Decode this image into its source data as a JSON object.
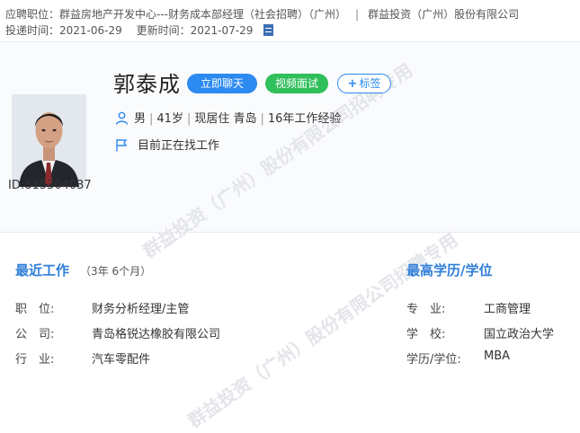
{
  "header": {
    "applied_label": "应聘职位：",
    "applied_position": "群益房地产开发中心---财务成本部经理（社会招聘）（广州）",
    "separator": "|",
    "company": "群益投资（广州）股份有限公司",
    "submit_label": "投递时间：",
    "submit_date": "2021-06-29",
    "update_label": "更新时间：",
    "update_date": "2021-07-29"
  },
  "profile": {
    "name": "郭泰成",
    "chat_button": "立即聊天",
    "video_button": "视频面试",
    "tag_button": "标签",
    "tag_plus": "+",
    "gender": "男",
    "age": "41岁",
    "residence": "现居住 青岛",
    "experience": "16年工作经验",
    "status": "目前正在找工作",
    "id_label": "ID:",
    "id_value": "815304037"
  },
  "watermark": {
    "line_a": "群益投资（广州）股份有限公司招聘专用",
    "line_b": "群益投资（广州）股份有限公司招聘专用"
  },
  "recent_work": {
    "title": "最近工作",
    "duration": "（3年 6个月）",
    "position_label": "职　位:",
    "position_value": "财务分析经理/主管",
    "company_label": "公　司:",
    "company_value": "青岛格锐达橡胶有限公司",
    "industry_label": "行　业:",
    "industry_value": "汽车零配件"
  },
  "education": {
    "title": "最高学历/学位",
    "major_label": "专　业:",
    "major_value": "工商管理",
    "school_label": "学　校:",
    "school_value": "国立政治大学",
    "degree_label": "学历/学位:",
    "degree_value": "MBA"
  },
  "colors": {
    "accent_blue": "#2c8af0",
    "accent_green": "#2fbf5b",
    "section_title": "#2f7ed8"
  }
}
